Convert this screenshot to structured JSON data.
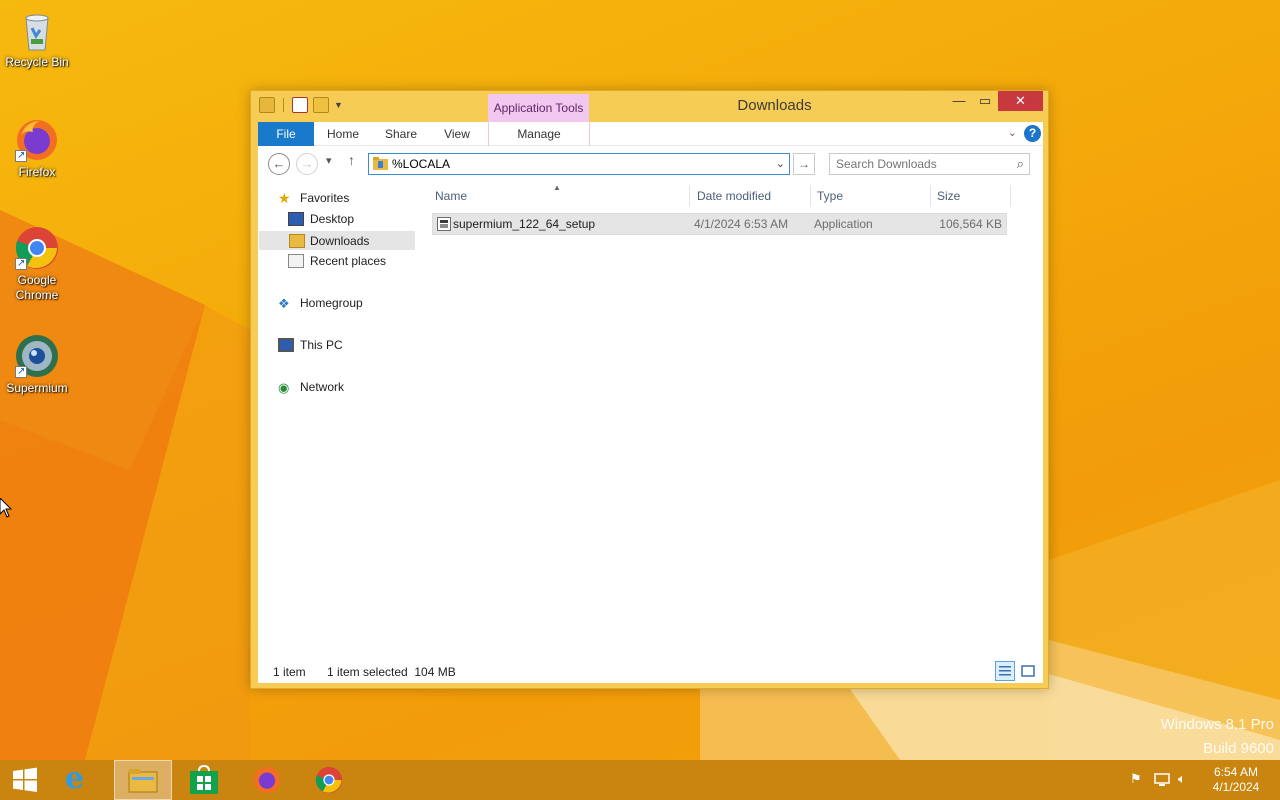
{
  "desktop": {
    "icons": [
      {
        "label": "Recycle Bin"
      },
      {
        "label": "Firefox"
      },
      {
        "label": "Google Chrome"
      },
      {
        "label": "Supermium"
      }
    ],
    "watermark": {
      "line1": "Windows 8.1 Pro",
      "line2": "Build 9600"
    }
  },
  "explorer": {
    "title": "Downloads",
    "context_tab": "Application Tools",
    "ribbon_tabs": {
      "file": "File",
      "home": "Home",
      "share": "Share",
      "view": "View",
      "manage": "Manage"
    },
    "address": {
      "value": "%LOCALA"
    },
    "search": {
      "placeholder": "Search Downloads"
    },
    "nav": {
      "favorites": "Favorites",
      "desktop": "Desktop",
      "downloads": "Downloads",
      "recent": "Recent places",
      "homegroup": "Homegroup",
      "this_pc": "This PC",
      "network": "Network"
    },
    "columns": {
      "name": "Name",
      "date": "Date modified",
      "type": "Type",
      "size": "Size"
    },
    "files": [
      {
        "name": "supermium_122_64_setup",
        "date": "4/1/2024 6:53 AM",
        "type": "Application",
        "size": "106,564 KB"
      }
    ],
    "status": {
      "count": "1 item",
      "selection": "1 item selected  104 MB"
    }
  },
  "taskbar": {
    "clock": {
      "time": "6:54 AM",
      "date": "4/1/2024"
    }
  },
  "colors": {
    "accent": "#1979ca",
    "close": "#c7383f",
    "context_tab": "#f2c8ee"
  }
}
